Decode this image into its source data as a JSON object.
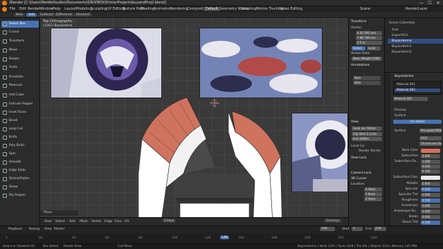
{
  "window": {
    "title": "Blender [C:\\Users\\MeddeStudios\\Documents\\DROPBOX\\PrinterProjects\\buyandProj2.blend]",
    "minimize": "—",
    "maximize": "☐",
    "close": "✕"
  },
  "menu": {
    "items": [
      "File",
      "Edit",
      "Render",
      "Window",
      "Help"
    ],
    "workspaces": [
      "Layout",
      "Modeling",
      "Sculpting",
      "UV Editing",
      "Texture Paint",
      "Shading",
      "Animation",
      "Rendering",
      "Compositing",
      "Default",
      "Geometry Nodes",
      "Scripting",
      "Motion Tracking",
      "Video Editing"
    ],
    "active_workspace": "Default",
    "scene_label": "Scene",
    "view_layer_label": "RenderLayer"
  },
  "viewport_header": {
    "items": [
      "New",
      "Add",
      "Subtract",
      "Difference",
      "Intersect"
    ],
    "active": "Add"
  },
  "viewport": {
    "view_name": "Top Orthographic",
    "collection_info": "(1161) Bayanderm",
    "operator_panel": "Move"
  },
  "toolbar": {
    "tools": [
      "Select Box",
      "Cursor",
      "Transform",
      "Move",
      "Rotate",
      "Scale",
      "Annotate",
      "Measure",
      "Add Cube",
      "Extrude Region",
      "Inset Faces",
      "Bevel",
      "Loop Cut",
      "Knife",
      "Poly Build",
      "Spin",
      "Smooth",
      "Edge Slide",
      "Shrink/Fatten",
      "Shear",
      "Rip Region"
    ],
    "selected": "Select Box"
  },
  "npanel": {
    "transform_title": "Transform",
    "vertex_label": "Vertex:",
    "vx": "X 42.591 mm",
    "vy": "Y 88.748 mm",
    "vz": "Z 0 m",
    "global": "Global",
    "local": "Local",
    "vertex_data": "Vertex Data:",
    "mean_weight": "Mean Weight 0.000",
    "annotations_title": "Annotations",
    "note_label": "Note",
    "focal_length": "Focal Len 50mm",
    "clip_start": "Clip Start 0.1mm",
    "clip_end": "End 1000m",
    "local_camera": "Local Ca",
    "render_region": "Render Border",
    "view_title": "View",
    "view_lock": "View Lock",
    "camera_lock": "Camera Lock",
    "cursor_title": "3D Cursor",
    "location_label": "Location:",
    "lx": "X 0mm",
    "ly": "Y 0mm",
    "lz": "Z 0mm"
  },
  "outliner": {
    "title": "Scene Collection",
    "rows": [
      "Axis",
      "Export011",
      "Bayanderme",
      "Bayanderm1",
      "Bayanderm2"
    ],
    "selected": "Bayanderme"
  },
  "properties": {
    "object_name": "Bayanderme",
    "material_slot_1": "Material.001",
    "material_slot_2": "Material.002",
    "material_name": "Material.001",
    "preview_label": "Preview",
    "surface_label": "Surface",
    "use_nodes": "Use Nodes",
    "surface_value": "Principled BSDF",
    "ggx": "GGX",
    "christensen": "Christensen-Bu...",
    "fields": [
      {
        "label": "Base Color",
        "value": ""
      },
      {
        "label": "Subsurface",
        "value": "0.000"
      },
      {
        "label": "Subsurface Ra...",
        "value": "1.000"
      },
      {
        "label": "",
        "value": "0.200"
      },
      {
        "label": "",
        "value": "0.100"
      },
      {
        "label": "Subsurface Colo...",
        "value": ""
      },
      {
        "label": "Metallic",
        "value": "0.000"
      },
      {
        "label": "Specular",
        "value": "0.500"
      },
      {
        "label": "Specular Tint",
        "value": "0.000"
      },
      {
        "label": "Roughness",
        "value": "0.500"
      },
      {
        "label": "Anisotropic",
        "value": "0.000"
      },
      {
        "label": "Anisotropic Ro...",
        "value": "0.000"
      },
      {
        "label": "Sheen",
        "value": "0.000"
      },
      {
        "label": "Sheen Tint",
        "value": "0.500"
      },
      {
        "label": "Clearcoat",
        "value": "0.000"
      },
      {
        "label": "Clearcoat Ro...",
        "value": "0.030"
      }
    ],
    "base_color_hex": "#d9705a",
    "subsurface_color_hex": "#e8e8e8"
  },
  "timeline": {
    "playback": "Playback",
    "keying": "Keying",
    "view": "View",
    "marker": "Marker",
    "current_frame": "148",
    "start_label": "Start",
    "start_value": "1",
    "end_label": "End",
    "end_value": "250",
    "ticks": [
      "0",
      "20",
      "40",
      "60",
      "80",
      "100",
      "120",
      "140",
      "160",
      "180",
      "200",
      "220",
      "240"
    ]
  },
  "edit_mode": {
    "mode": "Edit Mode",
    "menus": [
      "View",
      "Select",
      "Add",
      "Mesh",
      "Vertex",
      "Edge",
      "Face",
      "UV"
    ],
    "orientation": "Global",
    "overlays": "Overlays"
  },
  "status": {
    "left": "Select or Deselect All",
    "middle": "Box Select",
    "middle2": "Rotate View",
    "right": "Call Menu",
    "stats": "Bayanderme | Verts 1/20 | Faces 0/18 | Tris 0/0 | Objects 1/23 | Memory 145 MiB"
  },
  "colors": {
    "accent": "#4772b3",
    "salmon": "#cf735e",
    "mesh_white": "#ffffff"
  }
}
